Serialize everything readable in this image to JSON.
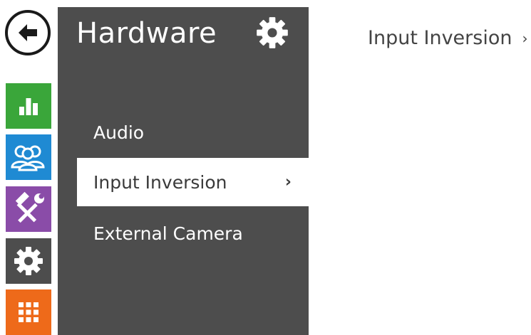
{
  "sidebar": {
    "icons": [
      {
        "name": "back-arrow-icon"
      },
      {
        "name": "status-chart-icon",
        "color": "#3aa63a"
      },
      {
        "name": "directory-users-icon",
        "color": "#1f8ad3"
      },
      {
        "name": "services-tools-icon",
        "color": "#8a4ca8"
      },
      {
        "name": "hardware-gear-icon",
        "color": "#4d4d4d"
      },
      {
        "name": "system-grid-icon",
        "color": "#ee6a1a"
      }
    ]
  },
  "menu": {
    "title": "Hardware",
    "items": [
      {
        "label": "Audio",
        "active": false
      },
      {
        "label": "Input Inversion",
        "active": true
      },
      {
        "label": "External Camera",
        "active": false
      }
    ],
    "chevron": "›"
  },
  "breadcrumb": {
    "label": "Input Inversion",
    "chevron": "›"
  },
  "colors": {
    "panel": "#4d4d4d",
    "text_light": "#ffffff",
    "text_dark": "#3a3a3a"
  }
}
